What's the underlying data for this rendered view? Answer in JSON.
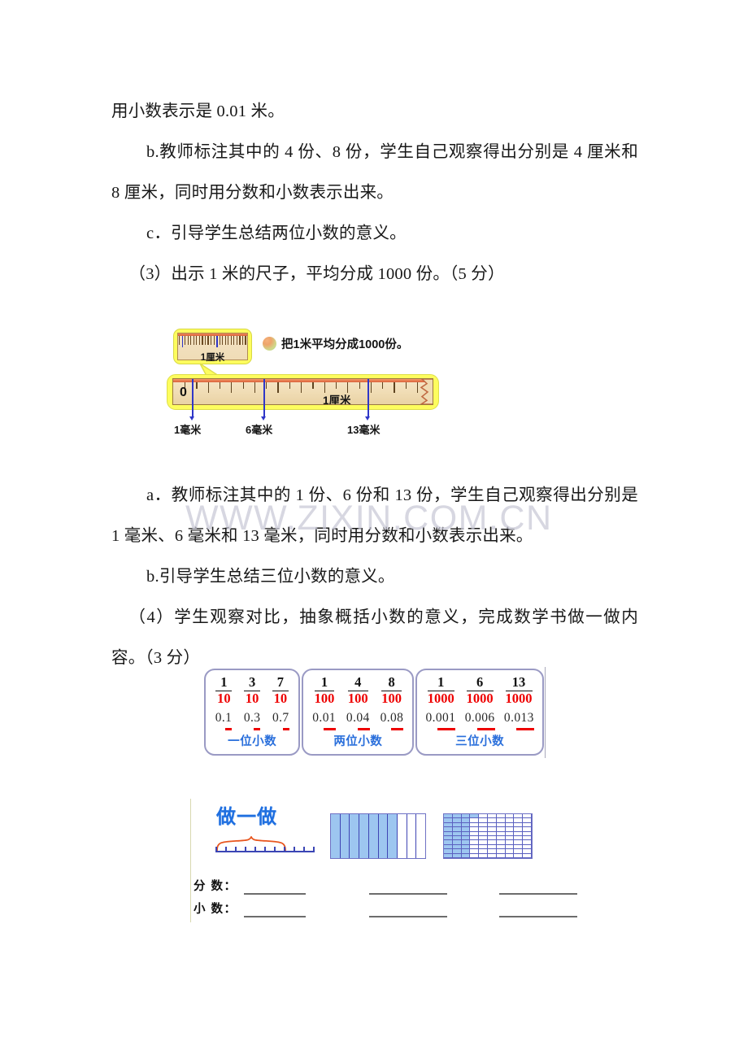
{
  "document": {
    "watermark": "www.zixin.com.cn"
  },
  "paragraphs": {
    "p1": "用小数表示是 0.01 米。",
    "p2": "b.教师标注其中的 4 份、8 份，学生自己观察得出分别是 4 厘米和 8 厘米，同时用分数和小数表示出来。",
    "p3": "c．引导学生总结两位小数的意义。",
    "p4": "（3）出示 1 米的尺子，平均分成 1000 份。（5 分）",
    "p5": "a．教师标注其中的 1 份、6 份和 13 份，学生自己观察得出分别是 1 毫米、6 毫米和 13 毫米，同时用分数和小数表示出来。",
    "p6": "b.引导学生总结三位小数的意义。",
    "p7": "（4）学生观察对比，抽象概括小数的意义，完成数学书做一做内容。（3 分）"
  },
  "ruler_figure": {
    "inset_label": "1厘米",
    "callout_text": "把1米平均分成1000份。",
    "zero_label": "0",
    "cm_label": "1厘米",
    "pointers": [
      {
        "label": "1毫米"
      },
      {
        "label": "6毫米"
      },
      {
        "label": "13毫米"
      }
    ]
  },
  "fraction_boxes": [
    {
      "caption": "一位小数",
      "fractions": [
        {
          "numerator": "1",
          "denominator": "10"
        },
        {
          "numerator": "3",
          "denominator": "10"
        },
        {
          "numerator": "7",
          "denominator": "10"
        }
      ],
      "decimals": [
        "0.1",
        "0.3",
        "0.7"
      ]
    },
    {
      "caption": "两位小数",
      "fractions": [
        {
          "numerator": "1",
          "denominator": "100"
        },
        {
          "numerator": "4",
          "denominator": "100"
        },
        {
          "numerator": "8",
          "denominator": "100"
        }
      ],
      "decimals": [
        "0.01",
        "0.04",
        "0.08"
      ]
    },
    {
      "caption": "三位小数",
      "fractions": [
        {
          "numerator": "1",
          "denominator": "1000"
        },
        {
          "numerator": "6",
          "denominator": "1000"
        },
        {
          "numerator": "13",
          "denominator": "1000"
        }
      ],
      "decimals": [
        "0.001",
        "0.006",
        "0.013"
      ]
    }
  ],
  "practice": {
    "title": "做一做",
    "number_line": {
      "ticks": 10,
      "brace_span": 6
    },
    "grid_tenths": {
      "columns": 10,
      "filled": 7
    },
    "grid_hundredths": {
      "rows": 10,
      "columns": 10,
      "filled": 31
    },
    "answer_rows": [
      {
        "label": "分 数："
      },
      {
        "label": "小 数："
      }
    ]
  },
  "colors": {
    "fraction_denominator": "#ee0000",
    "caption_blue": "#2a6fdb",
    "title_blue": "#1f6fe0",
    "pointer_blue": "#2f36c8",
    "grid_fill": "#9dc6f0",
    "ruler_yellow": "#fdfd5e",
    "ruler_wood": "#f0dcb4",
    "watermark": "#c9c9d6"
  }
}
